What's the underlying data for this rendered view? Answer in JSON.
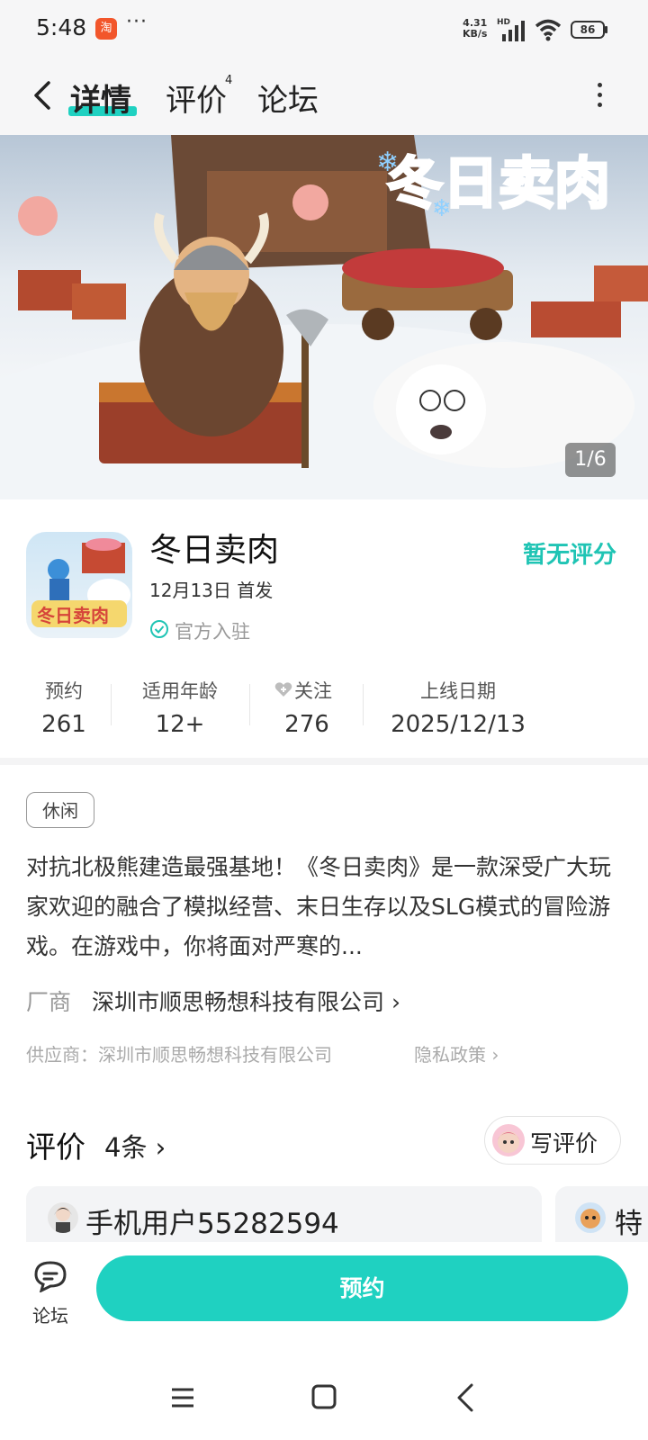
{
  "status_bar": {
    "time": "5:48",
    "app_badge": "淘",
    "dots": "···",
    "net_speed": "4.31",
    "net_unit": "KB/s",
    "hd": "HD",
    "battery": "86"
  },
  "nav": {
    "tab_detail": "详情",
    "tab_review": "评价",
    "tab_review_count": "4",
    "tab_forum": "论坛"
  },
  "banner": {
    "counter": "1/6"
  },
  "game": {
    "title": "冬日卖肉",
    "release": "12月13日 首发",
    "official": "官方入驻",
    "rating_text": "暂无评分"
  },
  "stats": [
    {
      "label": "预约",
      "value": "261"
    },
    {
      "label": "适用年龄",
      "value": "12+"
    },
    {
      "label": "关注",
      "value": "276"
    },
    {
      "label": "上线日期",
      "value": "2025/12/13"
    }
  ],
  "description": {
    "genre_tag": "休闲",
    "text": "对抗北极熊建造最强基地！《冬日卖肉》是一款深受广大玩家欢迎的融合了模拟经营、末日生存以及SLG模式的冒险游戏。在游戏中，你将面对严寒的...",
    "vendor_label": "厂商",
    "vendor_name": "深圳市顺思畅想科技有限公司 ›",
    "supplier": "供应商：深圳市顺思畅想科技有限公司",
    "privacy": "隐私政策 ›"
  },
  "reviews": {
    "title": "评价",
    "count": "4条 ›",
    "write_label": "写评价",
    "cards": [
      {
        "user": "手机用户55282594"
      },
      {
        "user": "特"
      }
    ]
  },
  "bottom": {
    "forum_label": "论坛",
    "reserve_label": "预约"
  },
  "colors": {
    "accent": "#1fd1c1",
    "rating": "#1fc4b4"
  }
}
